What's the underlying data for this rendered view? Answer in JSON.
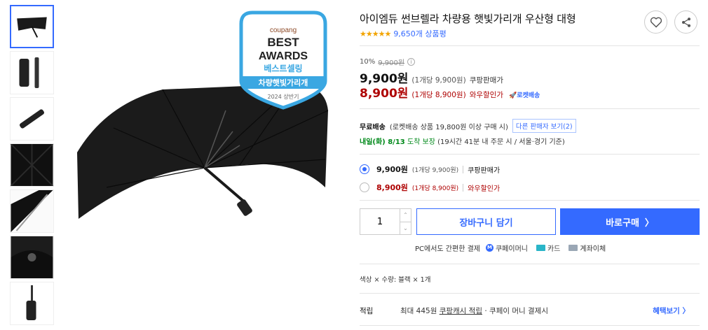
{
  "product": {
    "title": "아이엠듀 썬브렐라 차량용 햇빛가리개 우산형 대형",
    "stars": "★★★★★",
    "review_count": "9,650개 상품평",
    "image_alt": "자동차 앞유리용 검정 우산형 햇빛가리개"
  },
  "badge": {
    "brand": "coupang",
    "line1": "BEST",
    "line2": "AWARDS",
    "line3": "베스트셀링",
    "ribbon": "차량햇빛가리개",
    "year": "2024 상반기"
  },
  "icons": {
    "heart": "heart-icon",
    "share": "share-icon"
  },
  "price": {
    "discount_rate": "10%",
    "original": "9,900원",
    "info_icon": "i",
    "sale": "9,900원",
    "sale_unit": "(1개당 9,900원)",
    "sale_label": "쿠팡판매가",
    "wow": "8,900원",
    "wow_unit": "(1개당 8,900원)",
    "wow_label": "와우할인가",
    "rocket_label": "🚀로켓배송"
  },
  "shipping": {
    "free": "무료배송",
    "condition": "(로켓배송 상품 19,800원 이상 구매 시)",
    "other_seller": "다른 판매자 보기(2)",
    "arrival": "내일(화) 8/13",
    "arrival_suffix": "도착 보장",
    "arrival_note": "(19시간 41분 내 주문 시 / 서울·경기 기준)"
  },
  "options": [
    {
      "price": "9,900원",
      "unit": "(1개당 9,900원)",
      "label": "쿠팡판매가",
      "selected": true
    },
    {
      "price": "8,900원",
      "unit": "(1개당 8,900원)",
      "label": "와우할인가",
      "selected": false
    }
  ],
  "purchase": {
    "quantity": "1",
    "up": "⌃",
    "down": "⌄",
    "cart_label": "장바구니 담기",
    "buy_label": "바로구매",
    "buy_arrow": "〉"
  },
  "payment": {
    "label": "PC에서도 간편한 결제",
    "methods": [
      "쿠페이머니",
      "카드",
      "계좌이체"
    ],
    "m_letter": "M"
  },
  "selected_option": "색상 × 수량: 블랙 × 1개",
  "benefit": {
    "heading": "적립",
    "text_pre": "최대 445원",
    "link": "쿠팡캐시 적립",
    "text_post": "· 쿠페이 머니 결제시",
    "more": "혜택보기 〉"
  },
  "colors": {
    "accent": "#346aff",
    "wow_red": "#ae0000",
    "star": "#f2a400",
    "arrival_green": "#00891a"
  }
}
